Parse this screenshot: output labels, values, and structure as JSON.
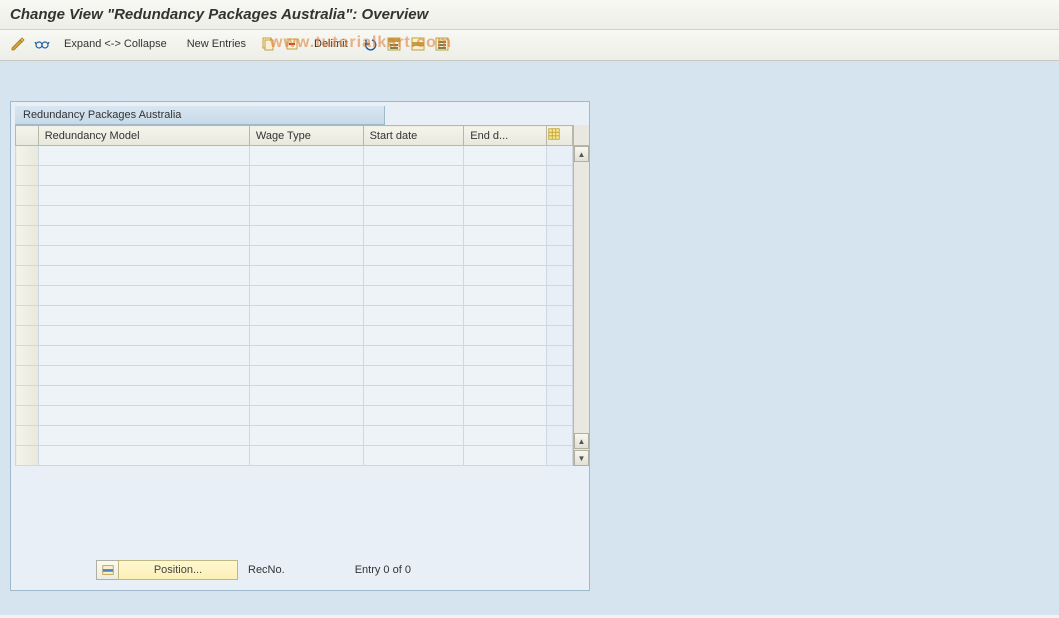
{
  "title": "Change View \"Redundancy Packages Australia\": Overview",
  "toolbar": {
    "expand_collapse": "Expand <-> Collapse",
    "new_entries": "New Entries",
    "delimit": "Delimit",
    "icons": {
      "change": "change-display-icon",
      "other_view": "glasses-icon",
      "copy": "copy-icon",
      "delete": "delete-icon",
      "undo": "undo-icon",
      "select_all": "select-all-icon",
      "select_block": "select-block-icon",
      "deselect_all": "deselect-all-icon",
      "table_settings": "table-settings-icon"
    }
  },
  "panel": {
    "title": "Redundancy Packages Australia",
    "columns": {
      "c1": "Redundancy Model",
      "c2": "Wage Type",
      "c3": "Start date",
      "c4": "End d..."
    },
    "config_icon": "configure-columns-icon"
  },
  "footer": {
    "position_label": "Position...",
    "recno_label": "RecNo.",
    "entry_text": "Entry 0 of 0"
  },
  "watermark": "www.tutorialkart.com",
  "grid": {
    "row_count": 16
  }
}
